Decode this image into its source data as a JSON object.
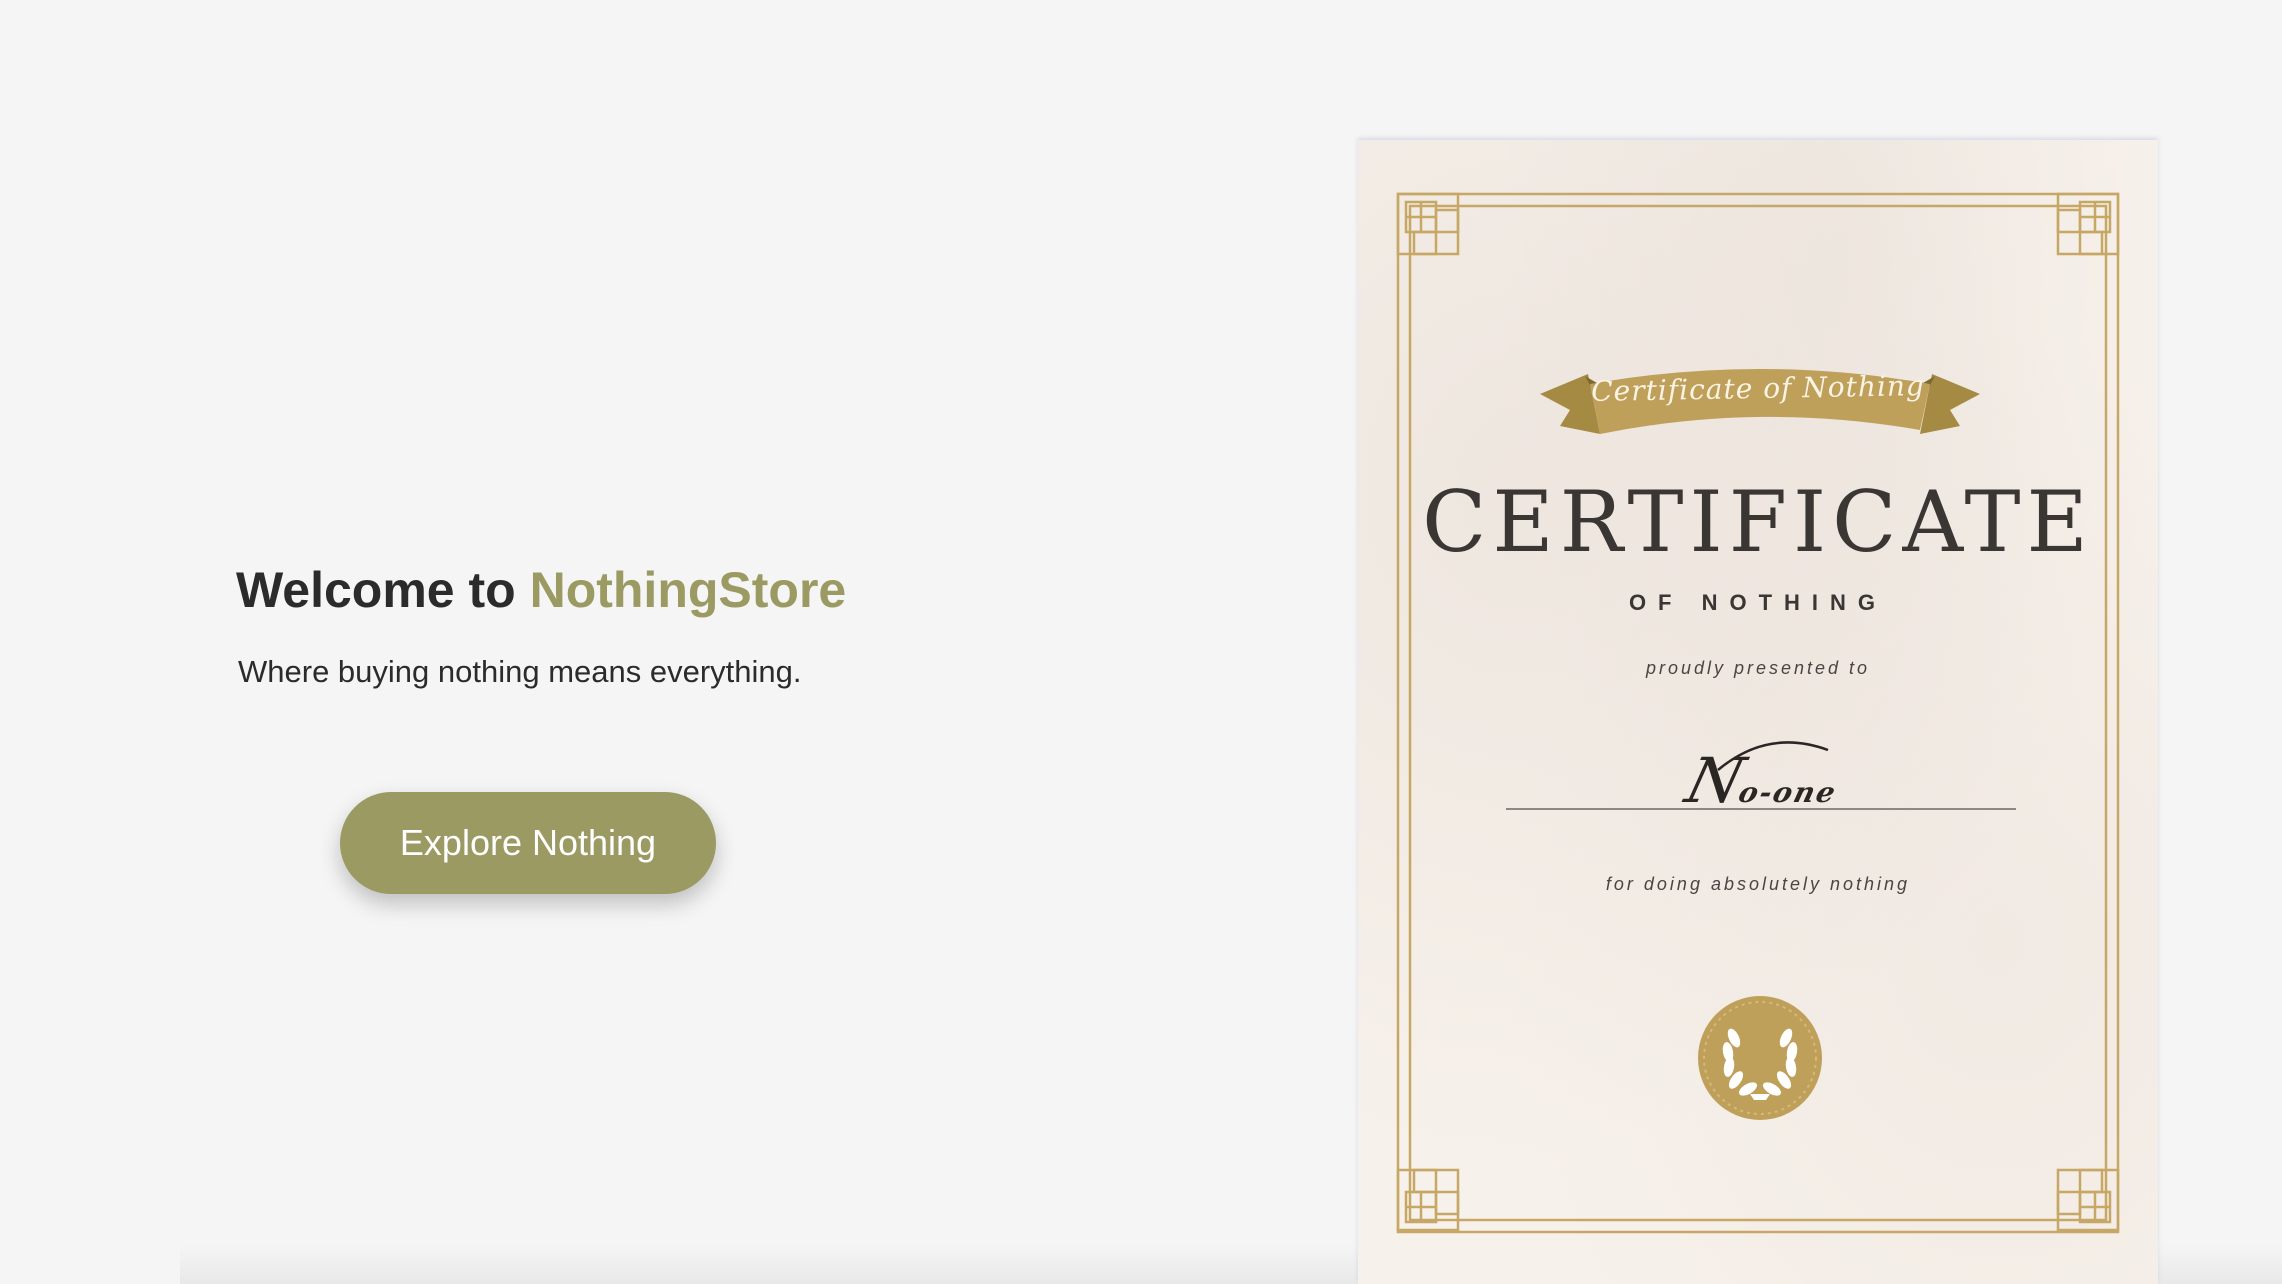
{
  "hero": {
    "title_prefix": "Welcome to ",
    "title_brand": "NothingStore",
    "subtitle": "Where buying nothing means everything.",
    "cta_label": "Explore Nothing"
  },
  "certificate": {
    "ribbon": "Certificate of Nothing",
    "heading": "CERTIFICATE",
    "subheading": "OF NOTHING",
    "presented": "proudly presented to",
    "recipient_initial": "N",
    "recipient_rest": "o-one",
    "reason": "for doing absolutely nothing"
  },
  "colors": {
    "brand": "#9b9a62",
    "gold": "#bfa05a",
    "background": "#f5f5f5",
    "paper": "#f7f1eb"
  },
  "icons": {
    "seal": "laurel-seal-icon",
    "frame": "ornamental-frame"
  }
}
